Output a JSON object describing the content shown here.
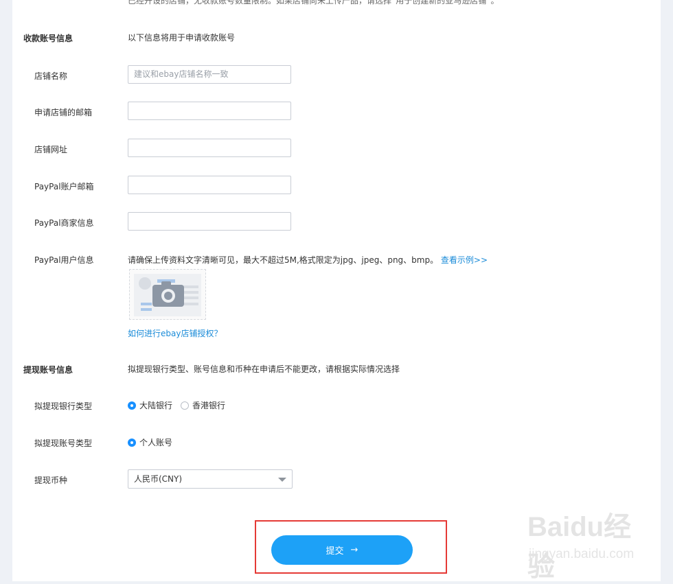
{
  "top_note": "已经开设的店铺，无收款账号数量限制。如果店铺尚未上传产品，请选择“用于创建新的亚马逊店铺”。",
  "receive": {
    "title": "收款账号信息",
    "desc": "以下信息将用于申请收款账号",
    "fields": [
      {
        "label": "店铺名称",
        "value": "",
        "placeholder": "建议和ebay店铺名称一致"
      },
      {
        "label": "申请店铺的邮箱",
        "value": "",
        "placeholder": ""
      },
      {
        "label": "店铺网址",
        "value": "",
        "placeholder": ""
      },
      {
        "label": "PayPal账户邮箱",
        "value": "",
        "placeholder": ""
      },
      {
        "label": "PayPal商家信息",
        "value": "",
        "placeholder": ""
      }
    ],
    "paypal_user_label": "PayPal用户信息",
    "upload_hint": "请确保上传资料文字清晰可见，最大不超过5M,格式限定为jpg、jpeg、png、bmp。",
    "view_example": "查看示例>>",
    "auth_link": "如何进行ebay店铺授权？"
  },
  "withdraw": {
    "title": "提现账号信息",
    "desc": "拟提现银行类型、账号信息和币种在申请后不能更改，请根据实际情况选择",
    "bank_type_label": "拟提现银行类型",
    "bank_options": [
      "大陆银行",
      "香港银行"
    ],
    "bank_selected": 0,
    "account_type_label": "拟提现账号类型",
    "account_options": [
      "个人账号"
    ],
    "currency_label": "提现币种",
    "currency_value": "人民币(CNY)"
  },
  "submit_label": "提交",
  "submit_arrow": "→",
  "watermark_main": "Baidu经验",
  "watermark_sub": "jingyan.baidu.com",
  "colors": {
    "accent": "#1da1f7",
    "highlight": "#e53935",
    "link": "#1a8bd8"
  }
}
